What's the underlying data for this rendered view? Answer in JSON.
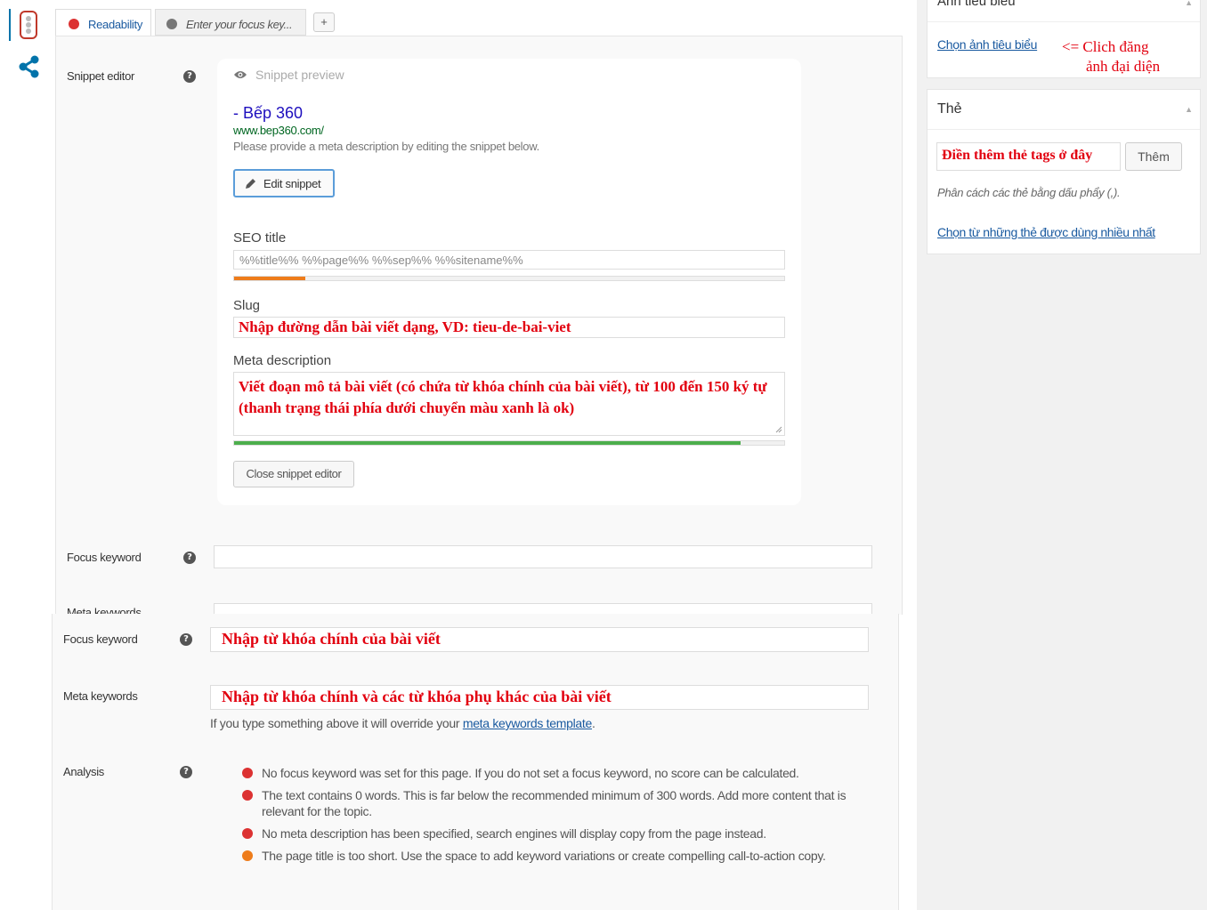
{
  "tabs": {
    "readability": "Readability",
    "focus_placeholder": "Enter your focus key...",
    "add": "+"
  },
  "snippet": {
    "row_label": "Snippet editor",
    "preview_label": "Snippet preview",
    "title": "- Bếp 360",
    "url": "www.bep360.com/",
    "description": "Please provide a meta description by editing the snippet below.",
    "edit_button": "Edit snippet",
    "seo_title_label": "SEO title",
    "seo_title_value": "%%title%% %%page%% %%sep%% %%sitename%%",
    "seo_title_progress": 0.13,
    "slug_label": "Slug",
    "slug_value": "Nhập đường dẫn bài viết dạng, VD: tieu-de-bai-viet",
    "meta_desc_label": "Meta description",
    "meta_desc_value": "Viết đoạn mô tả bài viết (có chứa từ khóa chính của bài viết), từ 100 đến 150 ký tự (thanh trạng thái phía dưới chuyển màu xanh là ok)",
    "meta_desc_progress": 0.92,
    "close_button": "Close snippet editor"
  },
  "upper": {
    "focus_label": "Focus keyword",
    "meta_kw_label": "Meta keywords"
  },
  "lower": {
    "focus_label": "Focus keyword",
    "focus_value": "Nhập từ khóa chính của bài viết",
    "meta_kw_label": "Meta keywords",
    "meta_kw_value": "Nhập từ khóa chính và các từ khóa phụ khác của bài viết",
    "override_prefix": "If you type something above it will override your ",
    "override_link": "meta keywords template",
    "override_suffix": ".",
    "analysis_label": "Analysis",
    "analysis": [
      {
        "text": "No focus keyword was set for this page. If you do not set a focus keyword, no score can be calculated.",
        "color": "#dc3232"
      },
      {
        "text": "The text contains 0 words. This is far below the recommended minimum of 300 words. Add more content that is relevant for the topic.",
        "color": "#dc3232"
      },
      {
        "text": "No meta description has been specified, search engines will display copy from the page instead.",
        "color": "#dc3232"
      },
      {
        "text": "The page title is too short. Use the space to add keyword variations or create compelling call-to-action copy.",
        "color": "#ee7c1b"
      }
    ]
  },
  "sidebar": {
    "featured_title": "Ảnh tiêu biểu",
    "featured_link": "Chọn ảnh tiêu biểu",
    "featured_note_1": "<= Clich đăng",
    "featured_note_2": "ảnh đại diện",
    "tags_title": "Thẻ",
    "tags_input": "Điền thêm thẻ tags ở đây",
    "tags_add_button": "Thêm",
    "tags_hint": "Phân cách các thẻ bằng dấu phẩy (,).",
    "tags_popular_link": "Chọn từ những thẻ được dùng nhiều nhất"
  },
  "colors": {
    "red_status": "#dc3232",
    "orange_status": "#ee7c1b",
    "green_progress": "#4cae4c",
    "link": "#1a5aa0",
    "annotation_red": "#e2000f"
  }
}
